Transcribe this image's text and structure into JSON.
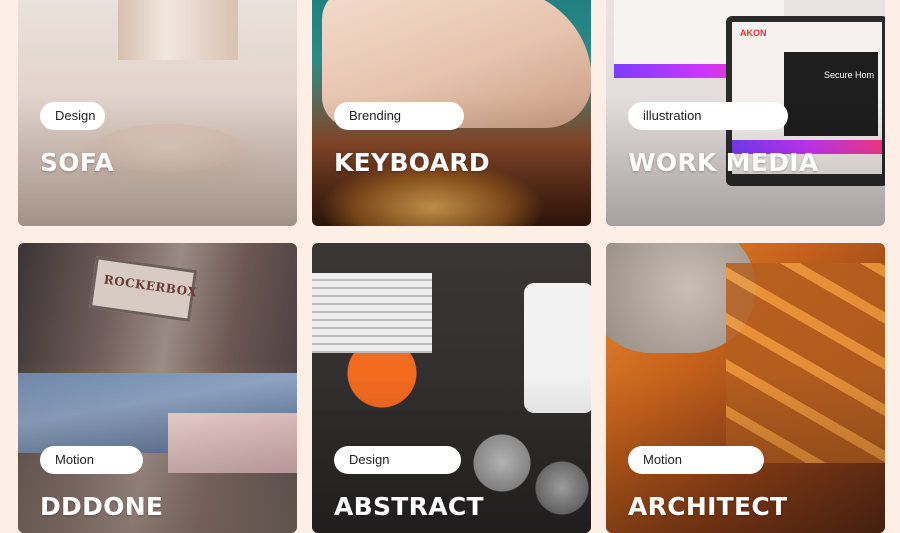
{
  "cards": [
    {
      "tag": "Design",
      "title": "SOFA"
    },
    {
      "tag": "Brending",
      "title": "KEYBOARD"
    },
    {
      "tag": "illustration",
      "title": "WORK MEDIA"
    },
    {
      "tag": "Motion",
      "title": "DDDONE"
    },
    {
      "tag": "Design",
      "title": "ABSTRACT"
    },
    {
      "tag": "Motion",
      "title": "ARCHITECT"
    }
  ],
  "image_text": {
    "rocker_sign": "ROCKERBOX",
    "akon_logo": "AKON",
    "secure_home": "Secure Hom"
  },
  "colors": {
    "page_background": "#fdeee6",
    "badge_background": "#ffffff",
    "title_text": "#ffffff"
  }
}
